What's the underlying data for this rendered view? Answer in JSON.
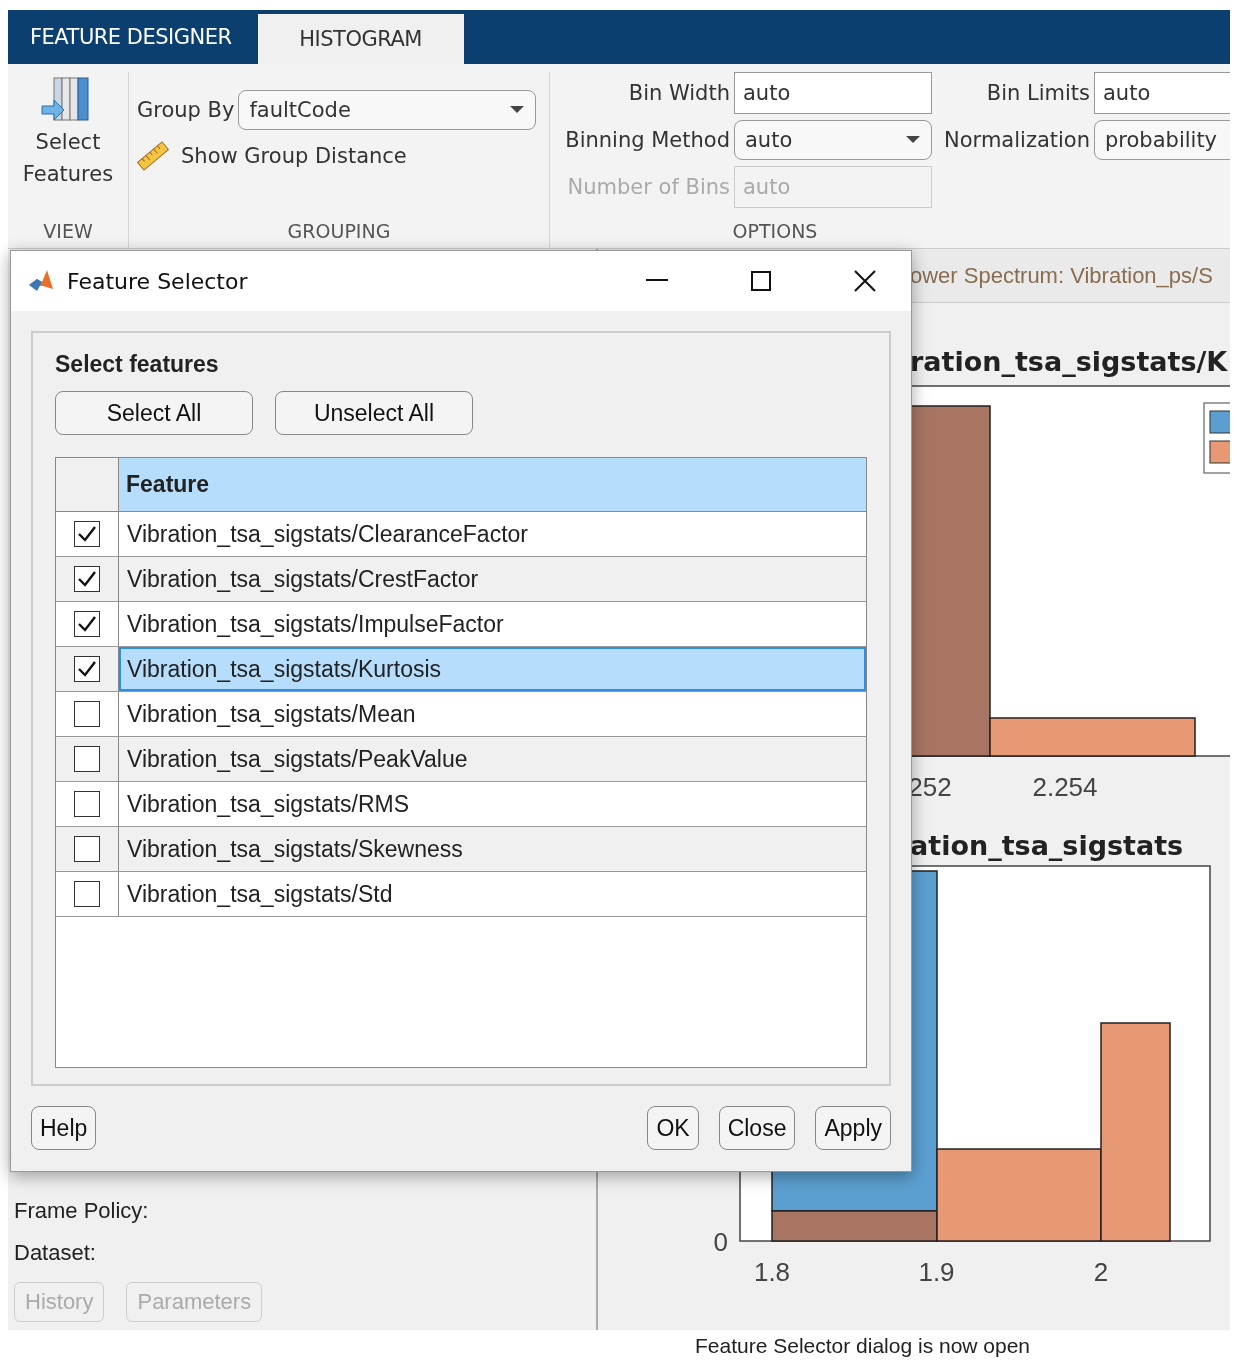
{
  "tabs": [
    {
      "label": "FEATURE DESIGNER",
      "selected": false
    },
    {
      "label": "HISTOGRAM",
      "selected": true
    }
  ],
  "view_section": {
    "title": "VIEW",
    "select_features": "Select Features"
  },
  "grouping_section": {
    "title": "GROUPING",
    "group_by": {
      "label": "Group By",
      "value": "faultCode"
    },
    "show_group_distance": "Show Group Distance"
  },
  "options_section": {
    "title": "OPTIONS",
    "fields": [
      {
        "label": "Bin Width",
        "value": "auto",
        "kind": "text",
        "disabled": false
      },
      {
        "label": "Binning Method",
        "value": "auto",
        "kind": "dropdown",
        "disabled": false
      },
      {
        "label": "Number of Bins",
        "value": "auto",
        "kind": "text",
        "disabled": true
      },
      {
        "label": "Bin Limits",
        "value": "auto",
        "kind": "text",
        "disabled": false
      },
      {
        "label": "Normalization",
        "value": "probability",
        "kind": "dropdown",
        "disabled": false
      }
    ]
  },
  "left_panel": {
    "properties": [
      "Frame Policy:",
      "Dataset:"
    ],
    "buttons": [
      {
        "label": "History",
        "disabled": true
      },
      {
        "label": "Parameters",
        "disabled": true
      }
    ]
  },
  "document_tab": "ower Spectrum: Vibration_ps/S",
  "plots": [
    {
      "title": "ration_tsa_sigstats/K",
      "x_ticks": [
        "252",
        "2.254"
      ]
    },
    {
      "title": "ation_tsa_sigstats",
      "y_ticks": [
        "0"
      ],
      "x_ticks": [
        "1.8",
        "1.9",
        "2"
      ]
    }
  ],
  "status_bar": "Feature Selector dialog is now open",
  "dialog": {
    "title": "Feature Selector",
    "panel_title": "Select features",
    "top_buttons": [
      "Select All",
      "Unselect All"
    ],
    "table": {
      "columns": [
        "Feature"
      ],
      "rows": [
        {
          "feature": "Vibration_tsa_sigstats/ClearanceFactor",
          "checked": true,
          "selected": false
        },
        {
          "feature": "Vibration_tsa_sigstats/CrestFactor",
          "checked": true,
          "selected": false
        },
        {
          "feature": "Vibration_tsa_sigstats/ImpulseFactor",
          "checked": true,
          "selected": false
        },
        {
          "feature": "Vibration_tsa_sigstats/Kurtosis",
          "checked": true,
          "selected": true
        },
        {
          "feature": "Vibration_tsa_sigstats/Mean",
          "checked": false,
          "selected": false
        },
        {
          "feature": "Vibration_tsa_sigstats/PeakValue",
          "checked": false,
          "selected": false
        },
        {
          "feature": "Vibration_tsa_sigstats/RMS",
          "checked": false,
          "selected": false
        },
        {
          "feature": "Vibration_tsa_sigstats/Skewness",
          "checked": false,
          "selected": false
        },
        {
          "feature": "Vibration_tsa_sigstats/Std",
          "checked": false,
          "selected": false
        }
      ]
    },
    "bottom_buttons": [
      "Help",
      "OK",
      "Close",
      "Apply"
    ]
  }
}
